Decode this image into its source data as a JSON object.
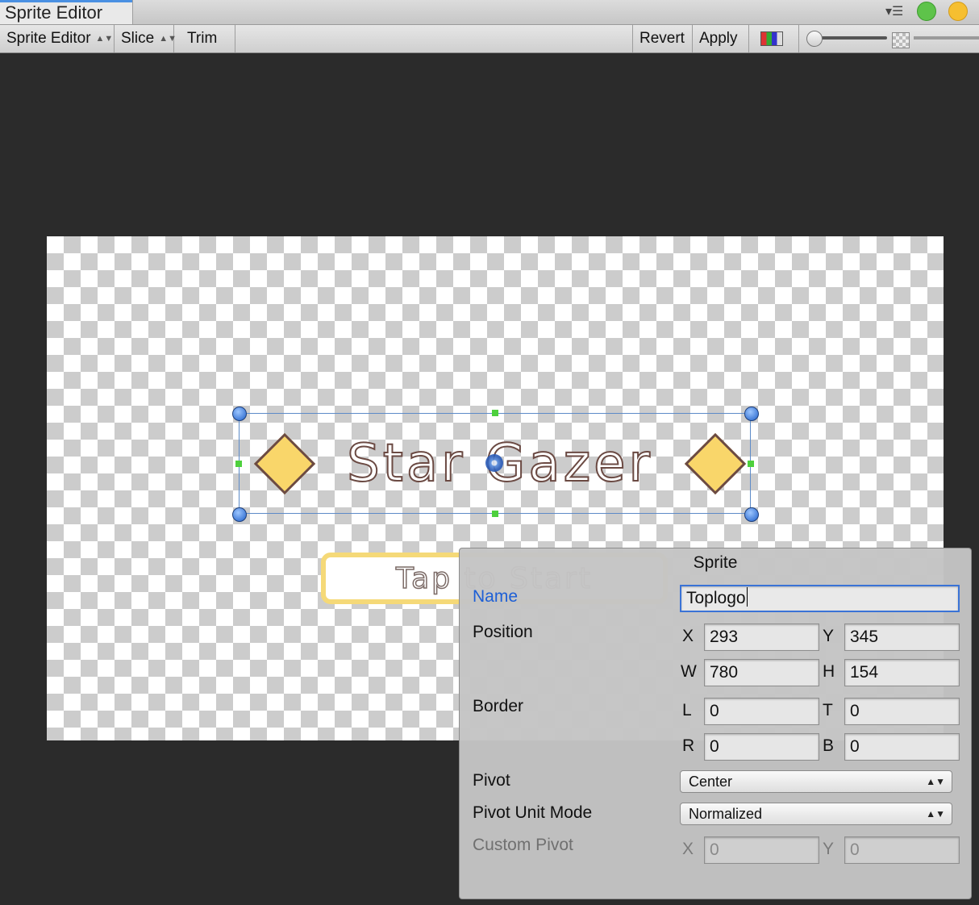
{
  "window": {
    "tab_title": "Sprite Editor"
  },
  "toolbar": {
    "sprite_editor_label": "Sprite Editor",
    "slice_label": "Slice",
    "trim_label": "Trim",
    "revert_label": "Revert",
    "apply_label": "Apply"
  },
  "canvas": {
    "logo_text": "Star Gazer",
    "tap_text": "Tap to Start"
  },
  "panel": {
    "title": "Sprite",
    "name_label": "Name",
    "name_value": "Toplogo",
    "position_label": "Position",
    "x_axis": "X",
    "x_value": "293",
    "y_axis": "Y",
    "y_value": "345",
    "w_axis": "W",
    "w_value": "780",
    "h_axis": "H",
    "h_value": "154",
    "border_label": "Border",
    "l_axis": "L",
    "l_value": "0",
    "t_axis": "T",
    "t_value": "0",
    "r_axis": "R",
    "r_value": "0",
    "b_axis": "B",
    "b_value": "0",
    "pivot_label": "Pivot",
    "pivot_value": "Center",
    "pivot_unit_label": "Pivot Unit Mode",
    "pivot_unit_value": "Normalized",
    "custom_pivot_label": "Custom Pivot",
    "cp_x_axis": "X",
    "cp_x_value": "0",
    "cp_y_axis": "Y",
    "cp_y_value": "0"
  },
  "colors": {
    "accent_blue": "#3a73d6",
    "handle_green": "#4ed03d",
    "logo_fill": "#f9d66a",
    "logo_outline": "#6b4a43",
    "canvas_background": "#2b2b2b"
  }
}
